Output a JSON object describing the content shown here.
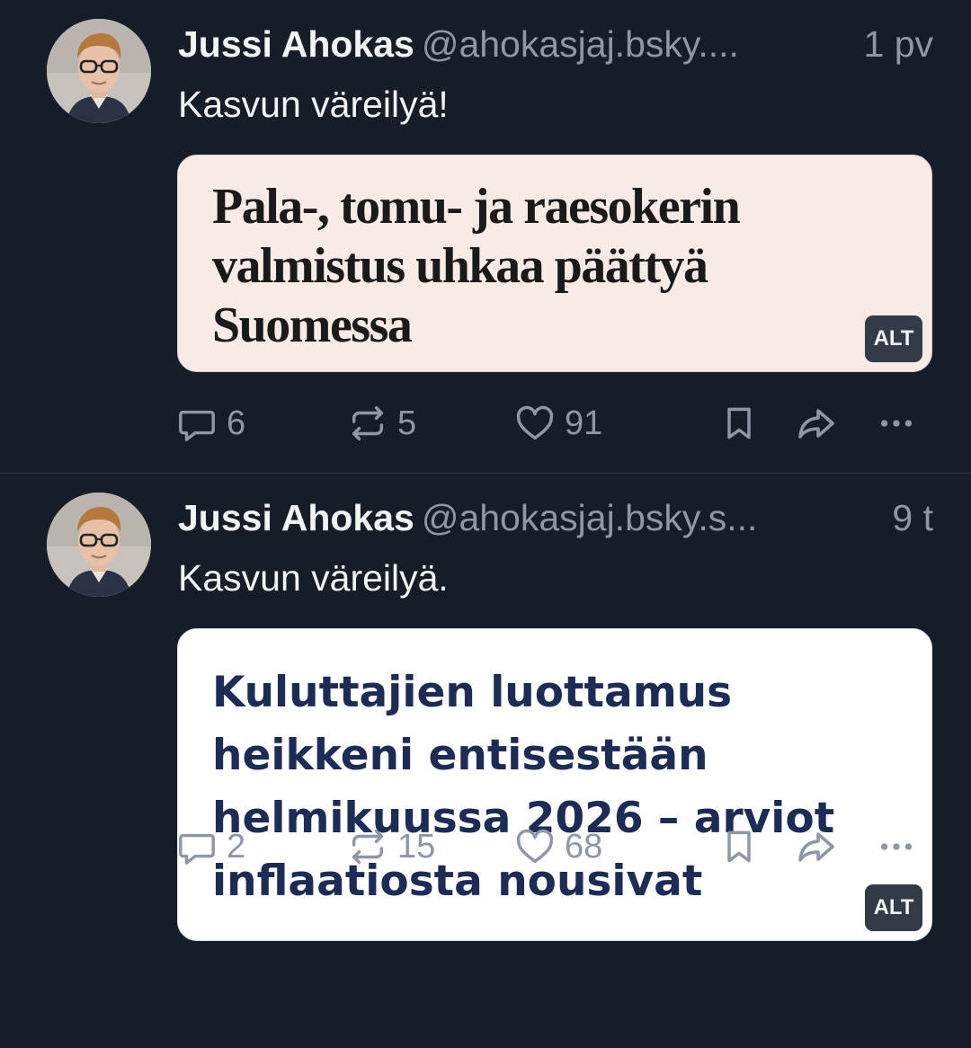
{
  "posts": [
    {
      "author": "Jussi Ahokas",
      "handle": "@ahokasjaj.bsky....",
      "time": "1 pv",
      "text": "Kasvun väreilyä!",
      "card": {
        "headline_lines": [
          "Pala-, tomu- ja raesokerin",
          "valmistus uhkaa päättyä",
          "Suomessa"
        ],
        "alt": "ALT",
        "background": "#f8ebe6"
      },
      "replies": "6",
      "reposts": "5",
      "likes": "91"
    },
    {
      "author": "Jussi Ahokas",
      "handle": "@ahokasjaj.bsky.s...",
      "time": "9 t",
      "text": "Kasvun väreilyä.",
      "card": {
        "headline_lines": [
          "Kuluttajien luottamus",
          "heikkeni entisestään",
          "helmikuussa 2026 – arviot",
          "inflaatiosta nousivat"
        ],
        "alt": "ALT",
        "background": "#ffffff"
      },
      "replies": "2",
      "reposts": "15",
      "likes": "68"
    }
  ],
  "icons": [
    "reply-icon",
    "repost-icon",
    "like-icon",
    "bookmark-icon",
    "share-icon",
    "more-icon"
  ],
  "colors": {
    "background": "#151d28",
    "muted": "#8d97a5",
    "headline_navy": "#1d2b57"
  }
}
